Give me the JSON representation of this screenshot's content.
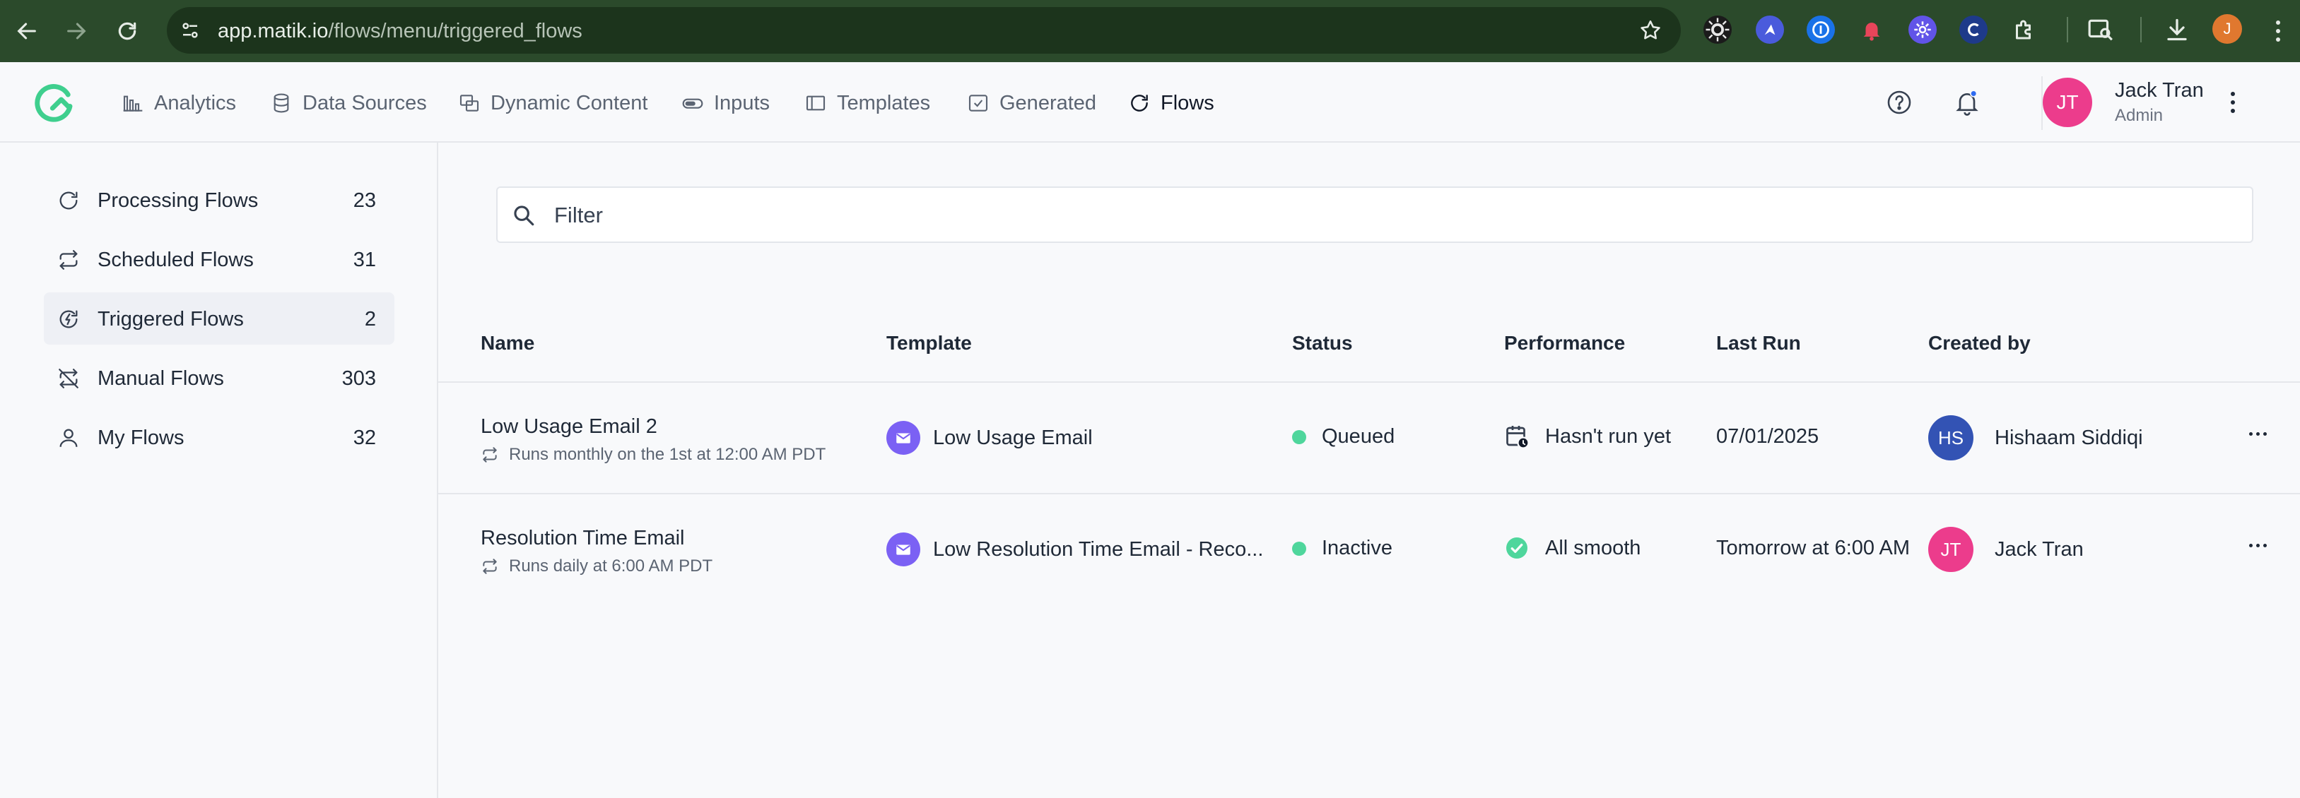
{
  "browser": {
    "url_host": "app.matik.io",
    "url_path": "/flows/menu/triggered_flows",
    "profile_initial": "J"
  },
  "nav": {
    "items": [
      {
        "label": "Analytics",
        "icon": "bar-chart-icon"
      },
      {
        "label": "Data Sources",
        "icon": "database-icon"
      },
      {
        "label": "Dynamic Content",
        "icon": "dynamic-content-icon"
      },
      {
        "label": "Inputs",
        "icon": "input-toggle-icon"
      },
      {
        "label": "Templates",
        "icon": "layout-icon"
      },
      {
        "label": "Generated",
        "icon": "check-square-icon"
      },
      {
        "label": "Flows",
        "icon": "refresh-icon"
      }
    ],
    "active": "Flows"
  },
  "user": {
    "initials": "JT",
    "name": "Jack Tran",
    "role": "Admin",
    "avatar_color": "#ec3c8c"
  },
  "sidebar": {
    "items": [
      {
        "label": "Processing Flows",
        "count": "23"
      },
      {
        "label": "Scheduled Flows",
        "count": "31"
      },
      {
        "label": "Triggered Flows",
        "count": "2"
      },
      {
        "label": "Manual Flows",
        "count": "303"
      },
      {
        "label": "My Flows",
        "count": "32"
      }
    ],
    "active": "Triggered Flows"
  },
  "filter": {
    "placeholder": "Filter"
  },
  "table": {
    "columns": [
      "Name",
      "Template",
      "Status",
      "Performance",
      "Last Run",
      "Created by"
    ],
    "rows": [
      {
        "name": "Low Usage Email 2",
        "schedule": "Runs monthly on the 1st at 12:00 AM PDT",
        "template": "Low Usage Email",
        "status": "Queued",
        "performance": "Hasn't run yet",
        "last_run": "07/01/2025",
        "creator_initials": "HS",
        "creator_name": "Hishaam Siddiqi",
        "creator_color": "#3353b4"
      },
      {
        "name": "Resolution Time Email",
        "schedule": "Runs daily at 6:00 AM PDT",
        "template": "Low Resolution Time Email - Reco...",
        "status": "Inactive",
        "performance": "All smooth",
        "last_run": "Tomorrow at 6:00 AM",
        "creator_initials": "JT",
        "creator_name": "Jack Tran",
        "creator_color": "#ec3c8c"
      }
    ]
  },
  "colors": {
    "accent": "#7b61f4",
    "status_dot": "#4fd69c",
    "logo": "#3fcf8e"
  }
}
